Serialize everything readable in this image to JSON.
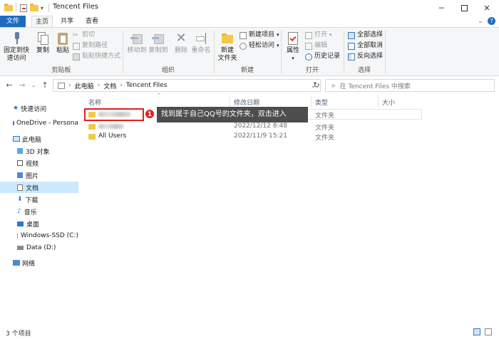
{
  "window": {
    "title": "Tencent Files"
  },
  "tabs": {
    "file": "文件",
    "home": "主页",
    "share": "共享",
    "view": "查看"
  },
  "ribbon": {
    "clipboard": {
      "label": "剪贴板",
      "pin": "固定到快\n速访问",
      "copy": "复制",
      "paste": "粘贴",
      "cut": "剪切",
      "copy_path": "复制路径",
      "paste_shortcut": "粘贴快捷方式"
    },
    "organize": {
      "label": "组织",
      "move_to": "移动到",
      "copy_to": "复制到",
      "delete": "删除",
      "rename": "重命名"
    },
    "new": {
      "label": "新建",
      "new_folder": "新建\n文件夹",
      "new_item": "新建项目",
      "easy_access": "轻松访问"
    },
    "open": {
      "label": "打开",
      "properties": "属性",
      "open": "打开",
      "edit": "编辑",
      "history": "历史记录"
    },
    "select": {
      "label": "选择",
      "select_all": "全部选择",
      "select_none": "全部取消",
      "invert": "反向选择"
    }
  },
  "address": {
    "path": [
      "此电脑",
      "文档",
      "Tencent Files"
    ],
    "search_placeholder": "在 Tencent Files 中搜索"
  },
  "sidebar": {
    "items": [
      {
        "label": "快速访问",
        "icon": "star-icon"
      },
      {
        "label": "OneDrive - Persona",
        "icon": "cloud-icon"
      },
      {
        "label": "此电脑",
        "icon": "computer-icon"
      },
      {
        "label": "3D 对象",
        "icon": "cube-icon"
      },
      {
        "label": "视频",
        "icon": "video-icon"
      },
      {
        "label": "图片",
        "icon": "picture-icon"
      },
      {
        "label": "文档",
        "icon": "document-icon"
      },
      {
        "label": "下载",
        "icon": "download-icon"
      },
      {
        "label": "音乐",
        "icon": "music-icon"
      },
      {
        "label": "桌面",
        "icon": "desktop-icon"
      },
      {
        "label": "Windows-SSD (C:)",
        "icon": "drive-icon"
      },
      {
        "label": "Data (D:)",
        "icon": "drive-icon"
      },
      {
        "label": "网络",
        "icon": "network-icon"
      }
    ]
  },
  "columns": {
    "name": "名称",
    "modified": "修改日期",
    "type": "类型",
    "size": "大小"
  },
  "files": [
    {
      "name": "",
      "modified": "",
      "type": "文件夹"
    },
    {
      "name": "",
      "modified": "2022/12/12 8:48",
      "type": "文件夹"
    },
    {
      "name": "All Users",
      "modified": "2022/11/9 15:21",
      "type": "文件夹"
    }
  ],
  "callout": {
    "number": "1",
    "text": "找到属于自己QQ号的文件夹，双击进入"
  },
  "status": {
    "count": "3 个项目"
  },
  "colors": {
    "accent": "#1e6cc1",
    "selection": "#cce8ff",
    "highlight": "#e02020",
    "folder": "#f2c94c"
  }
}
